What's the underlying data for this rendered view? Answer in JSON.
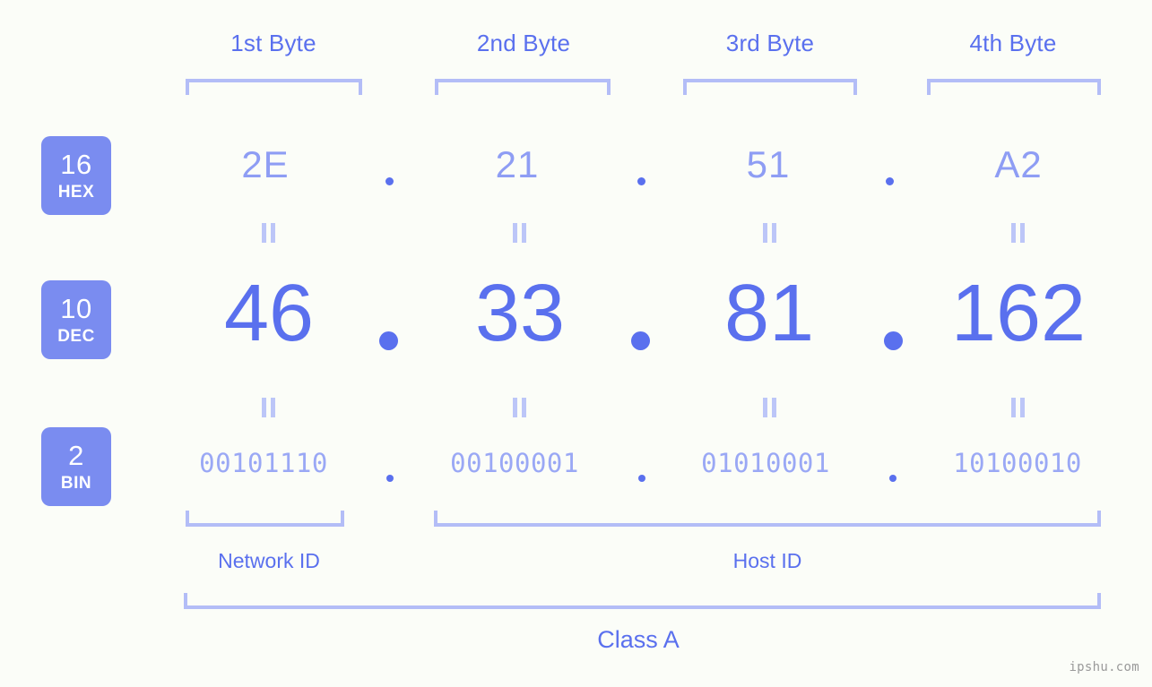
{
  "page": {
    "background_color": "#fbfdf8",
    "accent_color": "#5a70ee",
    "accent_light_color": "#b3bdf7",
    "badge_color": "#7a8cf0"
  },
  "byte_headers": [
    {
      "label": "1st Byte"
    },
    {
      "label": "2nd Byte"
    },
    {
      "label": "3rd Byte"
    },
    {
      "label": "4th Byte"
    }
  ],
  "bases": [
    {
      "number": "16",
      "unit": "HEX"
    },
    {
      "number": "10",
      "unit": "DEC"
    },
    {
      "number": "2",
      "unit": "BIN"
    }
  ],
  "rows": {
    "hex": {
      "base": "16",
      "unit": "HEX",
      "values": [
        "2E",
        "21",
        "51",
        "A2"
      ]
    },
    "dec": {
      "base": "10",
      "unit": "DEC",
      "values": [
        "46",
        "33",
        "81",
        "162"
      ]
    },
    "bin": {
      "base": "2",
      "unit": "BIN",
      "values": [
        "00101110",
        "00100001",
        "01010001",
        "10100010"
      ]
    }
  },
  "separator": ".",
  "equality_mark": "=",
  "sections": [
    {
      "label": "Network ID"
    },
    {
      "label": "Host ID"
    }
  ],
  "class": {
    "label": "Class A"
  },
  "watermark": {
    "text": "ipshu.com"
  }
}
